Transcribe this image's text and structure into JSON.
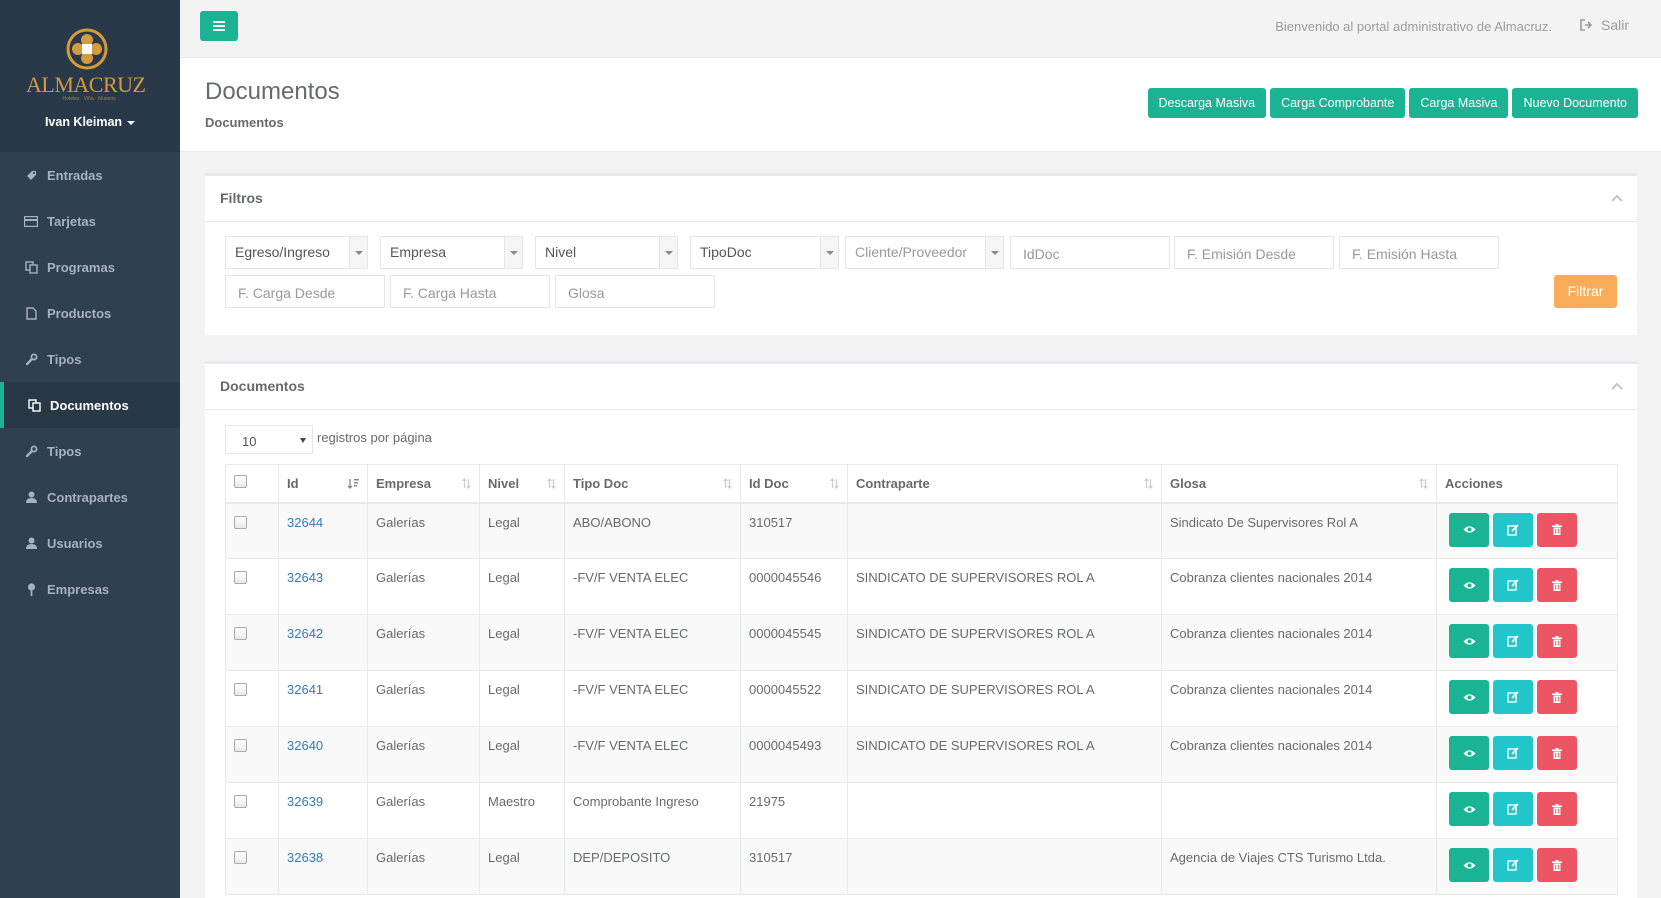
{
  "brand": {
    "name": "ALMACRUZ",
    "tagline": "Hoteles · Viña · Museos",
    "user": "Ivan Kleiman",
    "colors": {
      "accent": "#1ab394",
      "sidebar": "#2f4050",
      "warning": "#f8ac59",
      "danger": "#ed5565",
      "info": "#23c6c8"
    }
  },
  "sidebar": {
    "items": [
      {
        "label": "Entradas",
        "icon": "ticket-icon"
      },
      {
        "label": "Tarjetas",
        "icon": "credit-card-icon"
      },
      {
        "label": "Programas",
        "icon": "copy-icon"
      },
      {
        "label": "Productos",
        "icon": "file-icon"
      },
      {
        "label": "Tipos",
        "icon": "wrench-icon"
      },
      {
        "label": "Documentos",
        "icon": "documents-icon",
        "active": true
      },
      {
        "label": "Tipos",
        "icon": "wrench-icon"
      },
      {
        "label": "Contrapartes",
        "icon": "user-icon"
      },
      {
        "label": "Usuarios",
        "icon": "user-icon"
      },
      {
        "label": "Empresas",
        "icon": "map-marker-icon"
      }
    ]
  },
  "topbar": {
    "welcome": "Bienvenido al portal administrativo de Almacruz.",
    "logout": "Salir"
  },
  "heading": {
    "title": "Documentos",
    "breadcrumb": "Documentos",
    "buttons": [
      "Descarga Masiva",
      "Carga Comprobante",
      "Carga Masiva",
      "Nuevo Documento"
    ]
  },
  "filters": {
    "title": "Filtros",
    "selects": [
      "Egreso/Ingreso",
      "Empresa",
      "Nivel",
      "TipoDoc",
      "Cliente/Proveedor"
    ],
    "inputs": [
      "IdDoc",
      "F. Emisión Desde",
      "F. Emisión Hasta",
      "F. Carga Desde",
      "F. Carga Hasta",
      "Glosa"
    ],
    "button": "Filtrar"
  },
  "table_panel": {
    "title": "Documentos",
    "page_length": "10",
    "page_length_label": "registros por página",
    "columns": [
      "Id",
      "Empresa",
      "Nivel",
      "Tipo Doc",
      "Id Doc",
      "Contraparte",
      "Glosa",
      "Acciones"
    ],
    "rows": [
      {
        "id": "32644",
        "empresa": "Galerías",
        "nivel": "Legal",
        "tipo": "ABO/ABONO",
        "iddoc": "310517",
        "contraparte": "",
        "glosa": "Sindicato De Supervisores Rol A"
      },
      {
        "id": "32643",
        "empresa": "Galerías",
        "nivel": "Legal",
        "tipo": "-FV/F VENTA ELEC",
        "iddoc": "0000045546",
        "contraparte": "SINDICATO DE SUPERVISORES ROL A",
        "glosa": "Cobranza clientes nacionales 2014"
      },
      {
        "id": "32642",
        "empresa": "Galerías",
        "nivel": "Legal",
        "tipo": "-FV/F VENTA ELEC",
        "iddoc": "0000045545",
        "contraparte": "SINDICATO DE SUPERVISORES ROL A",
        "glosa": "Cobranza clientes nacionales 2014"
      },
      {
        "id": "32641",
        "empresa": "Galerías",
        "nivel": "Legal",
        "tipo": "-FV/F VENTA ELEC",
        "iddoc": "0000045522",
        "contraparte": "SINDICATO DE SUPERVISORES ROL A",
        "glosa": "Cobranza clientes nacionales 2014"
      },
      {
        "id": "32640",
        "empresa": "Galerías",
        "nivel": "Legal",
        "tipo": "-FV/F VENTA ELEC",
        "iddoc": "0000045493",
        "contraparte": "SINDICATO DE SUPERVISORES ROL A",
        "glosa": "Cobranza clientes nacionales 2014"
      },
      {
        "id": "32639",
        "empresa": "Galerías",
        "nivel": "Maestro",
        "tipo": "Comprobante Ingreso",
        "iddoc": "21975",
        "contraparte": "",
        "glosa": ""
      },
      {
        "id": "32638",
        "empresa": "Galerías",
        "nivel": "Legal",
        "tipo": "DEP/DEPOSITO",
        "iddoc": "310517",
        "contraparte": "",
        "glosa": "Agencia de Viajes CTS Turismo Ltda."
      }
    ]
  }
}
